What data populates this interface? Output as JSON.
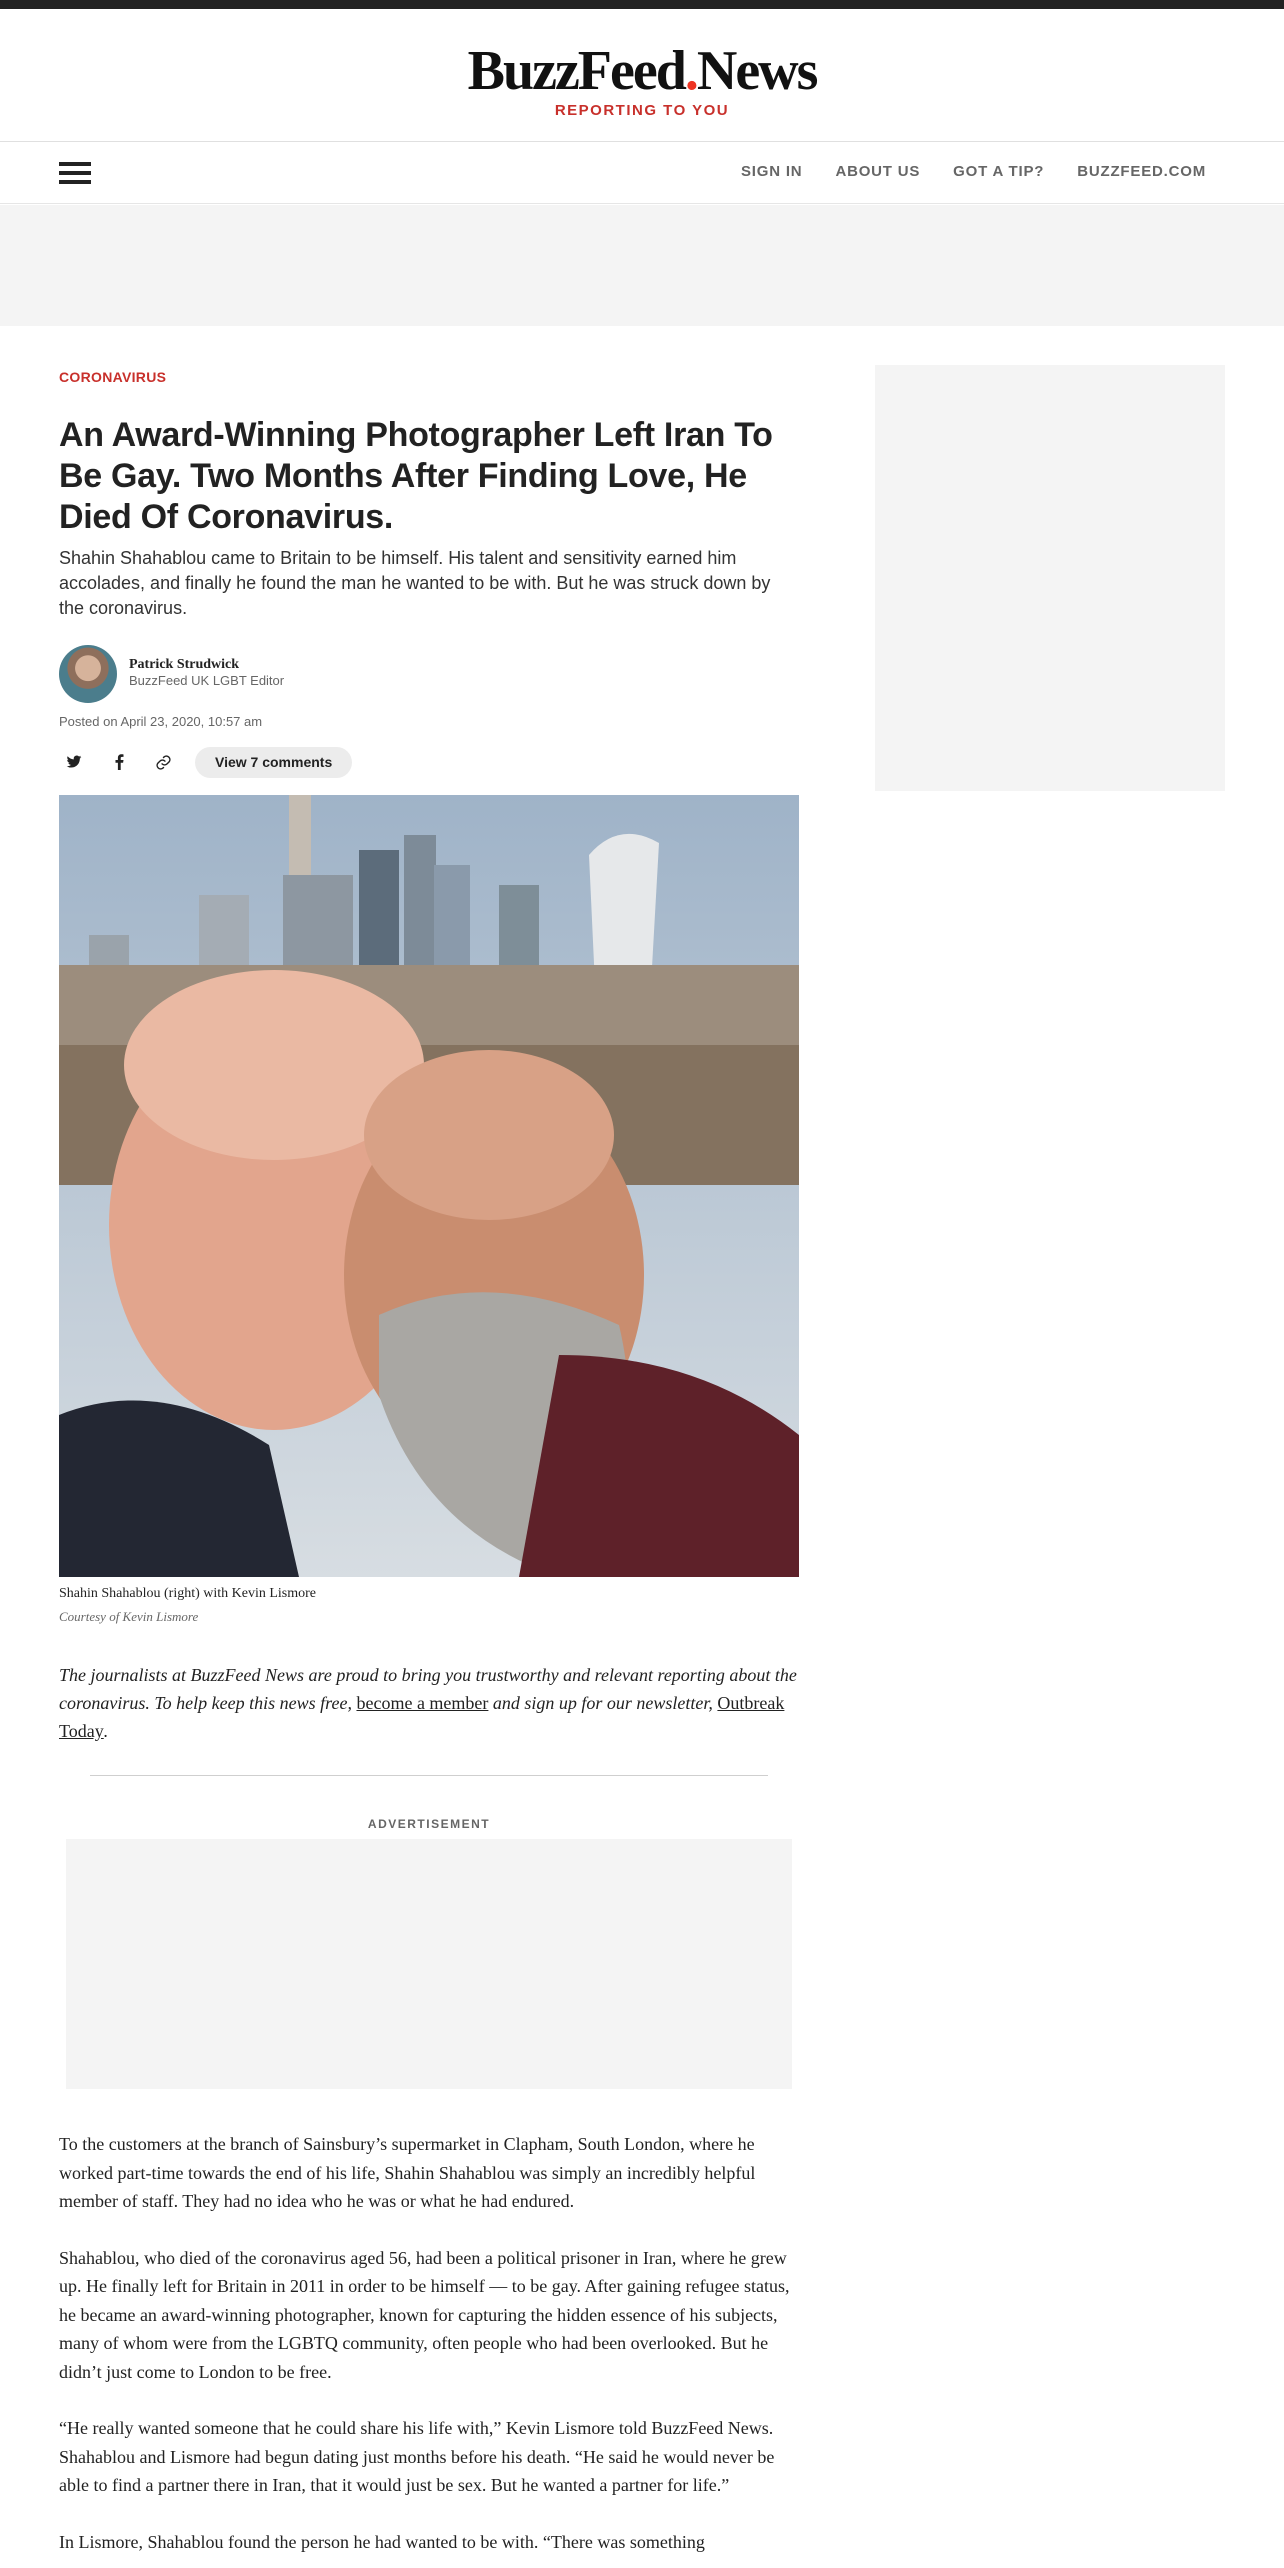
{
  "header": {
    "logo_main": "BuzzFeed",
    "logo_dot": ".",
    "logo_news": "News",
    "tagline": "REPORTING TO YOU"
  },
  "nav": {
    "links": [
      "SIGN IN",
      "ABOUT US",
      "GOT A TIP?",
      "BUZZFEED.COM"
    ]
  },
  "article": {
    "category": "CORONAVIRUS",
    "headline": "An Award-Winning Photographer Left Iran To Be Gay. Two Months After Finding Love, He Died Of Coronavirus.",
    "dek": "Shahin Shahablou came to Britain to be himself. His talent and sensitivity earned him accolades, and finally he found the man he wanted to be with. But he was struck down by the coronavirus.",
    "author_name": "Patrick Strudwick",
    "author_role": "BuzzFeed UK LGBT Editor",
    "posted": "Posted on April 23, 2020, 10:57 am",
    "comments_label": "View 7 comments",
    "photo_caption": "Shahin Shahablou (right) with Kevin Lismore",
    "photo_credit": "Courtesy of Kevin Lismore",
    "promo_part1": "The journalists at BuzzFeed News are proud to bring you trustworthy and relevant reporting about the coronavirus. To help keep this news free, ",
    "promo_link1": "become a member",
    "promo_part2": " and sign up for our newsletter, ",
    "promo_link2": "Outbreak Today",
    "promo_part3": ".",
    "ad_label": "ADVERTISEMENT",
    "paragraphs": [
      "To the customers at the branch of Sainsbury’s supermarket in Clapham, South London, where he worked part-time towards the end of his life, Shahin Shahablou was simply an incredibly helpful member of staff. They had no idea who he was or what he had endured.",
      "Shahablou, who died of the coronavirus aged 56, had been a political prisoner in Iran, where he grew up. He finally left for Britain in 2011 in order to be himself — to be gay. After gaining refugee status, he became an award-winning photographer, known for capturing the hidden essence of his subjects, many of whom were from the LGBTQ community, often people who had been overlooked. But he didn’t just come to London to be free.",
      "“He really wanted someone that he could share his life with,” Kevin Lismore told BuzzFeed News. Shahablou and Lismore had begun dating just months before his death. “He said he would never be able to find a partner there in Iran, that it would just be sex. But he wanted a partner for life.”",
      "In Lismore, Shahablou found the person he had wanted to be with. “There was something"
    ]
  },
  "icons": {
    "menu": "hamburger-icon",
    "twitter": "twitter-icon",
    "facebook": "facebook-icon",
    "link": "link-icon"
  },
  "colors": {
    "accent_red": "#c8302b",
    "top_bar": "#222222",
    "ad_placeholder": "#f4f4f4"
  }
}
